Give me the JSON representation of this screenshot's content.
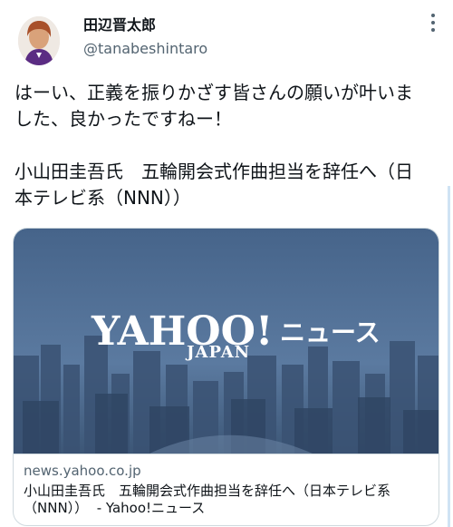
{
  "tweet": {
    "author_name": "田辺晋太郎",
    "author_handle": "@tanabeshintaro",
    "text_line1": "はーい、正義を振りかざす皆さんの願いが叶いま\nした、良かったですねー！",
    "text_line2": "小山田圭吾氏　五輪開会式作曲担当を辞任へ（日\n本テレビ系（NNN））"
  },
  "link_card": {
    "domain": "news.yahoo.co.jp",
    "title": "小山田圭吾氏　五輪開会式作曲担当を辞任へ（日本テレビ系\n（NNN））  - Yahoo!ニュース",
    "logo_main": "YAHOO!",
    "logo_sub": "JAPAN",
    "logo_news": "ニュース"
  },
  "icons": [
    "avatar",
    "more-options-icon"
  ],
  "colors": {
    "text_primary": "#0f1419",
    "text_secondary": "#536471",
    "card_border": "#cfd9de",
    "card_image_bg": "#4d6b8c"
  }
}
